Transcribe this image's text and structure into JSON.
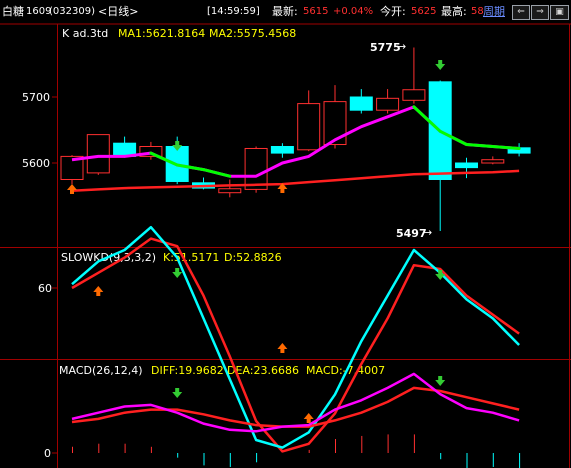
{
  "header": {
    "name": "白糖",
    "code": "1609",
    "code_paren": "(032309)",
    "period_label": "<日线>",
    "time": "[14:59:59]",
    "latest_label": "最新:",
    "latest_value": "5615",
    "change": "+0.04%",
    "open_label": "今开:",
    "open_value": "5625",
    "high_label": "最高:",
    "high_value": "58",
    "period_button": "周期"
  },
  "toolbar_icons": [
    "left-arrow-icon",
    "right-arrow-icon",
    "zoom-out-icon",
    "zoom-in-icon",
    "grid-icon"
  ],
  "colors": {
    "up": "#ff3030",
    "down": "#00ffff",
    "ma1": "#ff00ff",
    "ma2": "#00ff00",
    "label_yellow": "#ffff00",
    "axis": "#a00000"
  },
  "main_panel": {
    "title": "K  ad.3td",
    "ma1": "MA1:5621.8164",
    "ma2": "MA2:5575.4568",
    "y_labels": [
      "5700",
      "5600"
    ],
    "high_annotation": "5775",
    "low_annotation": "5497",
    "candles": [
      {
        "o": 5575,
        "c": 5610,
        "h": 5612,
        "l": 5568
      },
      {
        "o": 5585,
        "c": 5643,
        "h": 5643,
        "l": 5582
      },
      {
        "o": 5630,
        "c": 5610,
        "h": 5640,
        "l": 5608
      },
      {
        "o": 5610,
        "c": 5625,
        "h": 5632,
        "l": 5605
      },
      {
        "o": 5625,
        "c": 5572,
        "h": 5640,
        "l": 5568
      },
      {
        "o": 5570,
        "c": 5562,
        "h": 5578,
        "l": 5560
      },
      {
        "o": 5555,
        "c": 5561,
        "h": 5575,
        "l": 5548
      },
      {
        "o": 5560,
        "c": 5622,
        "h": 5625,
        "l": 5555
      },
      {
        "o": 5625,
        "c": 5615,
        "h": 5630,
        "l": 5608
      },
      {
        "o": 5620,
        "c": 5690,
        "h": 5710,
        "l": 5618
      },
      {
        "o": 5628,
        "c": 5693,
        "h": 5718,
        "l": 5622
      },
      {
        "o": 5700,
        "c": 5680,
        "h": 5712,
        "l": 5675
      },
      {
        "o": 5680,
        "c": 5698,
        "h": 5712,
        "l": 5675
      },
      {
        "o": 5695,
        "c": 5711,
        "h": 5775,
        "l": 5690
      },
      {
        "o": 5723,
        "c": 5575,
        "h": 5725,
        "l": 5497
      },
      {
        "o": 5600,
        "c": 5593,
        "h": 5608,
        "l": 5577
      },
      {
        "o": 5600,
        "c": 5605,
        "h": 5610,
        "l": 5598
      },
      {
        "o": 5623,
        "c": 5615,
        "h": 5630,
        "l": 5610
      }
    ],
    "ma1_values": [
      5605,
      5610,
      5610,
      5615,
      5597,
      5590,
      5580,
      5580,
      5600,
      5610,
      5635,
      5655,
      5670,
      5685,
      5648,
      5628,
      5625,
      5622
    ],
    "ma2_values": [
      5558,
      5560,
      5562,
      5563,
      5564,
      5565,
      5566,
      5567,
      5568,
      5571,
      5574,
      5577,
      5580,
      5583,
      5584,
      5585,
      5586,
      5588
    ]
  },
  "kd_panel": {
    "title": "SLOWKD(9,3,3,2)",
    "k": "K:51.5171",
    "d": "D:52.8826",
    "y_labels": [
      "60"
    ],
    "k_values": [
      61,
      67,
      70,
      76,
      68,
      52,
      36,
      20,
      18,
      22,
      32,
      46,
      58,
      70,
      64,
      57,
      52,
      45
    ],
    "d_values": [
      60,
      64,
      68,
      73,
      71,
      58,
      42,
      25,
      17,
      19,
      27,
      40,
      52,
      66,
      65,
      58,
      53,
      48
    ]
  },
  "macd_panel": {
    "title": "MACD(26,12,4)",
    "diff": "DIFF:19.9682",
    "dea": "DEA:23.6686",
    "macd": "MACD:-7.4007",
    "y_labels": [
      "0"
    ],
    "diff_values": [
      22,
      26,
      30,
      31,
      26,
      19,
      15,
      14,
      17,
      18,
      28,
      34,
      42,
      51,
      38,
      29,
      26,
      21
    ],
    "dea_values": [
      20,
      22,
      26,
      28,
      28,
      25,
      21,
      18,
      17,
      17,
      21,
      26,
      33,
      42,
      40,
      36,
      32,
      28
    ],
    "macd_values": [
      4,
      6,
      6,
      4,
      -3,
      -8,
      -9,
      -6,
      0,
      2,
      9,
      11,
      12,
      12,
      -4,
      -10,
      -9,
      -10
    ]
  }
}
